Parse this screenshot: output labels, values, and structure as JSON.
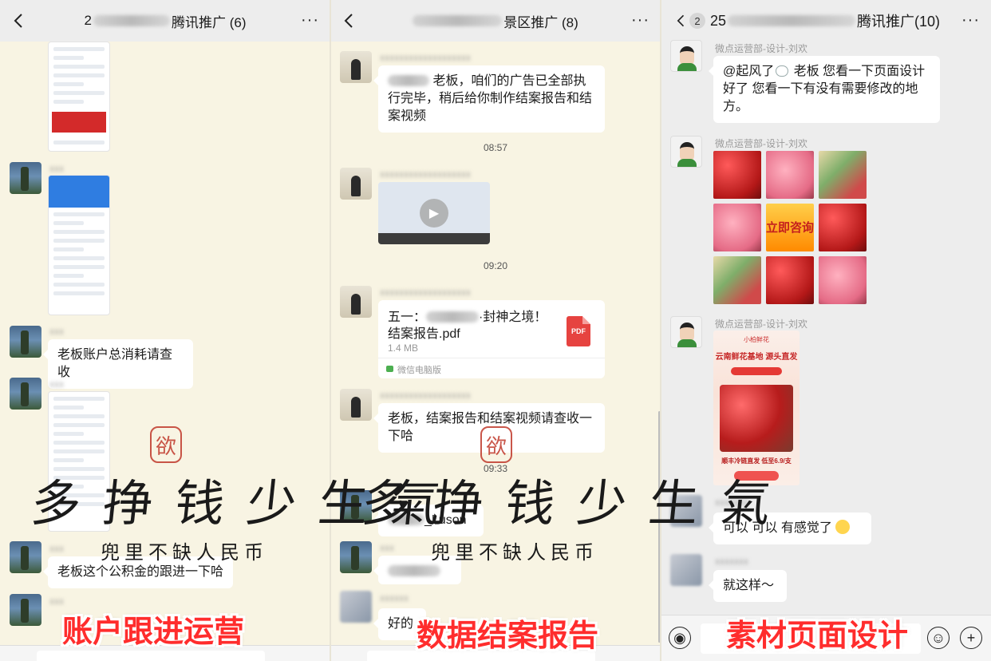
{
  "panels": [
    {
      "title": "腾讯推广 (6)",
      "title_prefix": "2",
      "messages": [
        {
          "text": "老板账户总消耗请查收"
        },
        {
          "text": "老板这个公积金的跟进一下哈"
        }
      ],
      "caption": "账户跟进运营"
    },
    {
      "title": "景区推广 (8)",
      "messages": [
        {
          "text": "老板，咱们的广告已全部执行完毕，稍后给你制作结案报告和结案视频"
        },
        {
          "text": "老板，结案报告和结案视频请查收一下哈"
        },
        {
          "text": "_Luson"
        },
        {
          "text": "好的"
        }
      ],
      "timestamps": [
        "08:57",
        "09:20",
        "09:33"
      ],
      "file": {
        "name_line1": "五一：",
        "name_line1_tail": "·封神之境！",
        "name_line2": "结案报告.pdf",
        "size": "1.4 MB",
        "source": "微信电脑版",
        "badge": "PDF"
      },
      "caption": "数据结案报告"
    },
    {
      "title": "腾讯推广(10)",
      "title_prefix": "25",
      "unread": "2",
      "sender": "微点运营部-设计-刘欢",
      "messages": [
        {
          "text_a": "@起风了",
          "text_b": "老板 您看一下页面设计好了  您看一下有没有需要修改的地方。"
        },
        {
          "text": "可以 可以 有感觉了"
        },
        {
          "text": "就这样～"
        }
      ],
      "grid_cta": "立即咨询",
      "poster": {
        "top": "小柏鲜花",
        "title": "云南鲜花基地 源头直发",
        "footer": "顺丰冷链直发 低至6.9/支"
      },
      "caption": "素材页面设计"
    }
  ],
  "watermark": {
    "main": "多挣钱少生氣",
    "sub": "兜里不缺人民币",
    "seal": "欲"
  },
  "colors": {
    "caption_red": "#ff2d2d",
    "chat_bg": "#f8f4e3",
    "bubble": "#ffffff"
  },
  "icons": [
    "back-icon",
    "more-icon",
    "play-icon",
    "pdf-icon",
    "voice-icon",
    "emoji-icon",
    "plus-icon"
  ]
}
